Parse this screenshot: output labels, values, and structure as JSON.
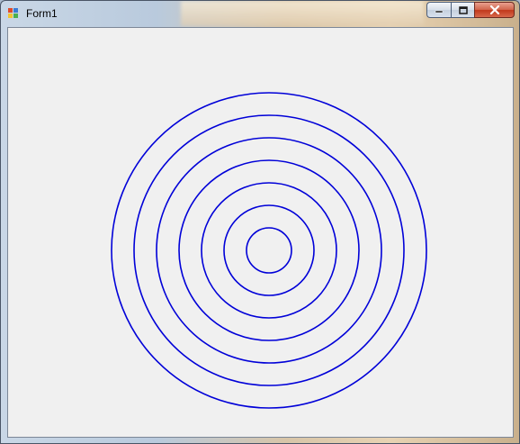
{
  "window": {
    "title": "Form1",
    "icons": {
      "app": "form-app-icon",
      "minimize": "minimize-icon",
      "maximize": "maximize-icon",
      "close": "close-icon"
    }
  },
  "drawing": {
    "shape": "concentric-circles",
    "count": 7,
    "stroke_color": "#0000d8",
    "background_color": "#f0f0f0"
  }
}
